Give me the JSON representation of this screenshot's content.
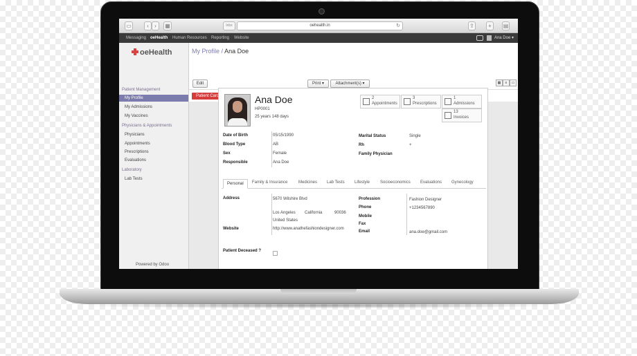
{
  "browser": {
    "url": "oehealth.in",
    "tag_btn": "Inbx"
  },
  "topnav": {
    "items": [
      "Messaging",
      "oeHealth",
      "Human Resources",
      "Reporting",
      "Website"
    ],
    "user": "Ana Doe ▾"
  },
  "sidebar": {
    "brand_prefix": "",
    "brand": "oeHealth",
    "sections": [
      {
        "title": "Patient Management",
        "items": [
          "My Profile",
          "My Admissions",
          "My Vaccines"
        ]
      },
      {
        "title": "Physicians & Appointments",
        "items": [
          "Physicians",
          "Appointments",
          "Prescriptions",
          "Evaluations"
        ]
      },
      {
        "title": "Laboratory",
        "items": [
          "Lab Tests"
        ]
      }
    ],
    "active_item": "My Profile",
    "powered_by": "Powered by Odoo"
  },
  "header": {
    "breadcrumb_parent": "My Profile",
    "breadcrumb_sep": "/",
    "breadcrumb_current": "Ana Doe",
    "edit_label": "Edit",
    "print_label": "Print ▾",
    "attachments_label": "Attachment(s) ▾"
  },
  "patient_card_label": "Patient Card",
  "patient": {
    "name": "Ana Doe",
    "id": "HP0001",
    "age": "25 years 148 days",
    "stats": [
      {
        "num": "2",
        "label": "Appointments",
        "icon": "calendar-icon"
      },
      {
        "num": "3",
        "label": "Prescriptions",
        "icon": "list-icon"
      },
      {
        "num": "1",
        "label": "Admissions",
        "icon": "bed-icon"
      },
      {
        "num": "13",
        "label": "Invoices",
        "icon": "pencil-icon"
      }
    ],
    "fields_left": [
      {
        "label": "Date of Birth",
        "value": "05/15/1990"
      },
      {
        "label": "Blood Type",
        "value": "AB"
      },
      {
        "label": "Sex",
        "value": "Female"
      },
      {
        "label": "Responsible",
        "value": "Ana Doe"
      }
    ],
    "fields_right": [
      {
        "label": "Marital Status",
        "value": "Single"
      },
      {
        "label": "Rh",
        "value": "+"
      },
      {
        "label": "Family Physician",
        "value": ""
      }
    ]
  },
  "tabs": [
    "Personal",
    "Family & Insurance",
    "Medicines",
    "Lab Tests",
    "Lifestyle",
    "Socioeconomics",
    "Evaluations",
    "Gynecology"
  ],
  "personal": {
    "address_label": "Address",
    "street": "5670 Wilshire Blvd",
    "city": "Los Angeles",
    "state": "California",
    "zip": "90036",
    "country": "United States",
    "website_label": "Website",
    "website": "http://www.anathefashiondesigner.com",
    "deceased_label": "Patient Deceased ?",
    "profession_label": "Profession",
    "profession": "Fashion Designer",
    "phone_label": "Phone",
    "phone": "+1234567890",
    "mobile_label": "Mobile",
    "fax_label": "Fax",
    "email_label": "Email",
    "email": "ana.doe@gmail.com"
  }
}
